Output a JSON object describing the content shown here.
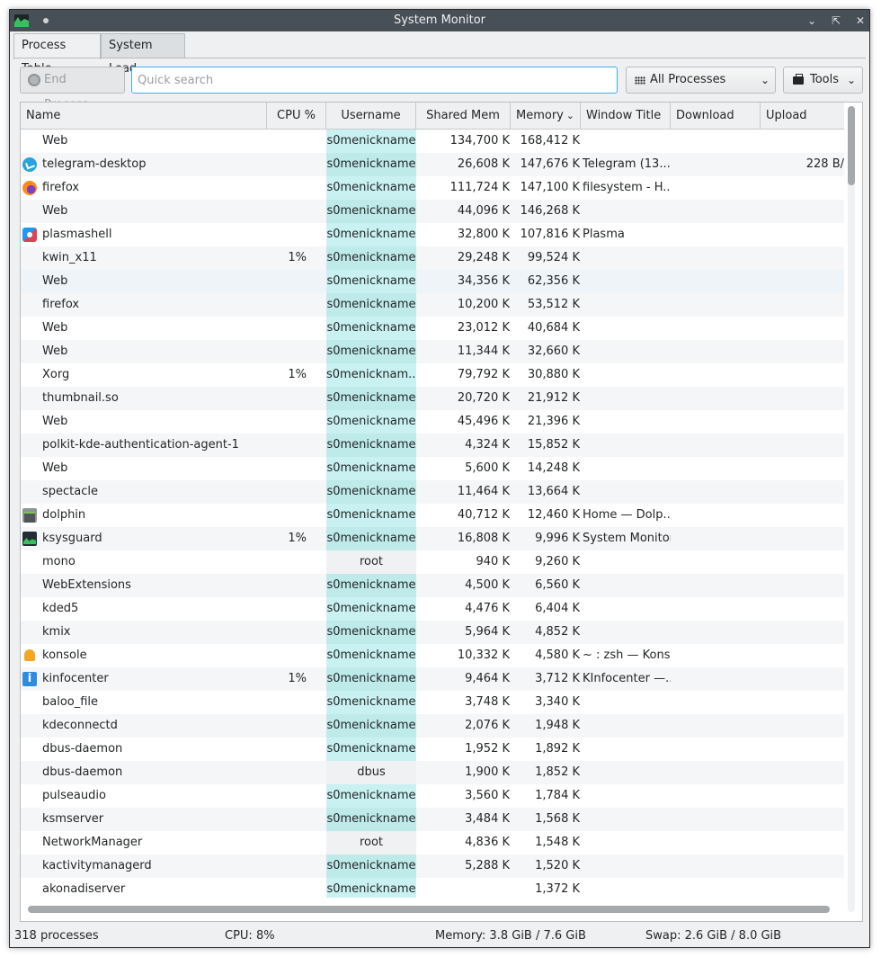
{
  "window": {
    "title": "System Monitor",
    "app_icon": "ksysguard-icon"
  },
  "tabs": [
    {
      "label": "Process Table",
      "active": true
    },
    {
      "label": "System Load",
      "active": false
    }
  ],
  "toolbar": {
    "end_process_label": "End Process...",
    "search_placeholder": "Quick search",
    "search_value": "",
    "filter_label": "All Processes",
    "tools_label": "Tools"
  },
  "columns": {
    "name": "Name",
    "cpu": "CPU %",
    "username": "Username",
    "shared_mem": "Shared Mem",
    "memory": "Memory",
    "window_title": "Window Title",
    "download": "Download",
    "upload": "Upload"
  },
  "rows": [
    {
      "icon": "",
      "name": "Web",
      "cpu": "",
      "user": "s0menickname",
      "shared": "134,700 K",
      "mem": "168,412 K",
      "win": "",
      "up": ""
    },
    {
      "icon": "telegram",
      "name": "telegram-desktop",
      "cpu": "",
      "user": "s0menickname",
      "shared": "26,608 K",
      "mem": "147,676 K",
      "win": "Telegram (13...",
      "up": "228 B/"
    },
    {
      "icon": "firefox",
      "name": "firefox",
      "cpu": "",
      "user": "s0menickname",
      "shared": "111,724 K",
      "mem": "147,100 K",
      "win": "filesystem - H...",
      "up": ""
    },
    {
      "icon": "",
      "name": "Web",
      "cpu": "",
      "user": "s0menickname",
      "shared": "44,096 K",
      "mem": "146,268 K",
      "win": "",
      "up": ""
    },
    {
      "icon": "plasma",
      "name": "plasmashell",
      "cpu": "",
      "user": "s0menickname",
      "shared": "32,800 K",
      "mem": "107,816 K",
      "win": "Plasma",
      "up": ""
    },
    {
      "icon": "",
      "name": "kwin_x11",
      "cpu": "1%",
      "user": "s0menickname",
      "shared": "29,248 K",
      "mem": "99,524 K",
      "win": "",
      "up": ""
    },
    {
      "icon": "",
      "name": "Web",
      "cpu": "",
      "user": "s0menickname",
      "shared": "34,356 K",
      "mem": "62,356 K",
      "win": "",
      "up": ""
    },
    {
      "icon": "",
      "name": "firefox",
      "cpu": "",
      "user": "s0menickname",
      "shared": "10,200 K",
      "mem": "53,512 K",
      "win": "",
      "up": ""
    },
    {
      "icon": "",
      "name": "Web",
      "cpu": "",
      "user": "s0menickname",
      "shared": "23,012 K",
      "mem": "40,684 K",
      "win": "",
      "up": ""
    },
    {
      "icon": "",
      "name": "Web",
      "cpu": "",
      "user": "s0menickname",
      "shared": "11,344 K",
      "mem": "32,660 K",
      "win": "",
      "up": ""
    },
    {
      "icon": "",
      "name": "Xorg",
      "cpu": "1%",
      "user": "s0menicknam...",
      "shared": "79,792 K",
      "mem": "30,880 K",
      "win": "",
      "up": ""
    },
    {
      "icon": "",
      "name": "thumbnail.so",
      "cpu": "",
      "user": "s0menickname",
      "shared": "20,720 K",
      "mem": "21,912 K",
      "win": "",
      "up": ""
    },
    {
      "icon": "",
      "name": "Web",
      "cpu": "",
      "user": "s0menickname",
      "shared": "45,496 K",
      "mem": "21,396 K",
      "win": "",
      "up": ""
    },
    {
      "icon": "",
      "name": "polkit-kde-authentication-agent-1",
      "cpu": "",
      "user": "s0menickname",
      "shared": "4,324 K",
      "mem": "15,852 K",
      "win": "",
      "up": ""
    },
    {
      "icon": "",
      "name": "Web",
      "cpu": "",
      "user": "s0menickname",
      "shared": "5,600 K",
      "mem": "14,248 K",
      "win": "",
      "up": ""
    },
    {
      "icon": "",
      "name": "spectacle",
      "cpu": "",
      "user": "s0menickname",
      "shared": "11,464 K",
      "mem": "13,664 K",
      "win": "",
      "up": ""
    },
    {
      "icon": "dolphin",
      "name": "dolphin",
      "cpu": "",
      "user": "s0menickname",
      "shared": "40,712 K",
      "mem": "12,460 K",
      "win": "Home — Dolp...",
      "up": ""
    },
    {
      "icon": "ksys",
      "name": "ksysguard",
      "cpu": "1%",
      "user": "s0menickname",
      "shared": "16,808 K",
      "mem": "9,996 K",
      "win": "System Monitor",
      "up": ""
    },
    {
      "icon": "",
      "name": "mono",
      "cpu": "",
      "user": "root",
      "shared": "940 K",
      "mem": "9,260 K",
      "win": "",
      "up": ""
    },
    {
      "icon": "",
      "name": "WebExtensions",
      "cpu": "",
      "user": "s0menickname",
      "shared": "4,500 K",
      "mem": "6,560 K",
      "win": "",
      "up": ""
    },
    {
      "icon": "",
      "name": "kded5",
      "cpu": "",
      "user": "s0menickname",
      "shared": "4,476 K",
      "mem": "6,404 K",
      "win": "",
      "up": ""
    },
    {
      "icon": "",
      "name": "kmix",
      "cpu": "",
      "user": "s0menickname",
      "shared": "5,964 K",
      "mem": "4,852 K",
      "win": "",
      "up": ""
    },
    {
      "icon": "konsole",
      "name": "konsole",
      "cpu": "",
      "user": "s0menickname",
      "shared": "10,332 K",
      "mem": "4,580 K",
      "win": "~ : zsh — Kons...",
      "up": ""
    },
    {
      "icon": "kinfo",
      "name": "kinfocenter",
      "cpu": "1%",
      "user": "s0menickname",
      "shared": "9,464 K",
      "mem": "3,712 K",
      "win": "KInfocenter —...",
      "up": ""
    },
    {
      "icon": "",
      "name": "baloo_file",
      "cpu": "",
      "user": "s0menickname",
      "shared": "3,748 K",
      "mem": "3,340 K",
      "win": "",
      "up": ""
    },
    {
      "icon": "",
      "name": "kdeconnectd",
      "cpu": "",
      "user": "s0menickname",
      "shared": "2,076 K",
      "mem": "1,948 K",
      "win": "",
      "up": ""
    },
    {
      "icon": "",
      "name": "dbus-daemon",
      "cpu": "",
      "user": "s0menickname",
      "shared": "1,952 K",
      "mem": "1,892 K",
      "win": "",
      "up": ""
    },
    {
      "icon": "",
      "name": "dbus-daemon",
      "cpu": "",
      "user": "dbus",
      "shared": "1,900 K",
      "mem": "1,852 K",
      "win": "",
      "up": ""
    },
    {
      "icon": "",
      "name": "pulseaudio",
      "cpu": "",
      "user": "s0menickname",
      "shared": "3,560 K",
      "mem": "1,784 K",
      "win": "",
      "up": ""
    },
    {
      "icon": "",
      "name": "ksmserver",
      "cpu": "",
      "user": "s0menickname",
      "shared": "3,484 K",
      "mem": "1,568 K",
      "win": "",
      "up": ""
    },
    {
      "icon": "",
      "name": "NetworkManager",
      "cpu": "",
      "user": "root",
      "shared": "4,836 K",
      "mem": "1,548 K",
      "win": "",
      "up": ""
    },
    {
      "icon": "",
      "name": "kactivitymanagerd",
      "cpu": "",
      "user": "s0menickname",
      "shared": "5,288 K",
      "mem": "1,520 K",
      "win": "",
      "up": ""
    },
    {
      "icon": "",
      "name": "akonadiserver",
      "cpu": "",
      "user": "s0menickname",
      "shared": "",
      "mem": "1,372 K",
      "win": "",
      "up": ""
    }
  ],
  "status": {
    "processes": "318 processes",
    "cpu": "CPU: 8%",
    "memory": "Memory: 3.8 GiB / 7.6 GiB",
    "swap": "Swap: 2.6 GiB / 8.0 GiB"
  },
  "colors": {
    "accent": "#3daee9",
    "user_highlight": "#c9f1f1",
    "titlebar": "#475057"
  }
}
